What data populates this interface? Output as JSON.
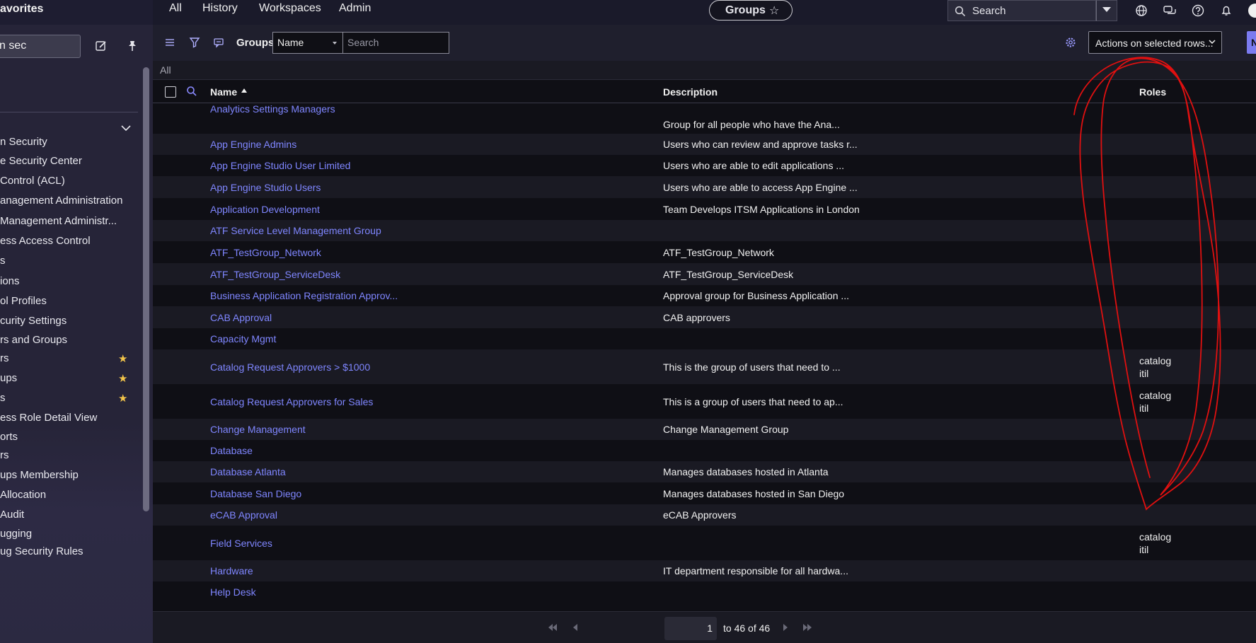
{
  "top_nav": {
    "favorites_label": "avorites",
    "menus": [
      "All",
      "History",
      "Workspaces",
      "Admin"
    ],
    "workspace_title": "Groups",
    "search_label": "Search"
  },
  "sidebar": {
    "filter_value": "n sec",
    "items": [
      {
        "label": "n Security",
        "starred": false
      },
      {
        "label": "e Security Center",
        "starred": false
      },
      {
        "label": "Control (ACL)",
        "starred": false
      },
      {
        "label": "anagement Administration",
        "starred": false
      },
      {
        "label": "Management Administr...",
        "starred": false
      },
      {
        "label": "ess Access Control",
        "starred": false
      },
      {
        "label": "s",
        "starred": false
      },
      {
        "label": "ions",
        "starred": false
      },
      {
        "label": "ol Profiles",
        "starred": false
      },
      {
        "label": "curity Settings",
        "starred": false
      },
      {
        "label": "rs and Groups",
        "starred": false
      },
      {
        "label": "rs",
        "starred": true
      },
      {
        "label": "ups",
        "starred": true
      },
      {
        "label": "s",
        "starred": true
      },
      {
        "label": "ess Role Detail View",
        "starred": false
      },
      {
        "label": "orts",
        "starred": false
      },
      {
        "label": "rs",
        "starred": false
      },
      {
        "label": "ups Membership",
        "starred": false
      },
      {
        "label": "Allocation",
        "starred": false
      },
      {
        "label": "Audit",
        "starred": false
      },
      {
        "label": "ugging",
        "starred": false
      },
      {
        "label": "ug Security Rules",
        "starred": false
      }
    ]
  },
  "list": {
    "title": "Groups",
    "field_select": "Name",
    "search_placeholder": "Search",
    "actions_label": "Actions on selected rows...",
    "new_button": "N",
    "breadcrumb": "All",
    "columns": {
      "name": "Name",
      "description": "Description",
      "roles": "Roles"
    },
    "rows": [
      {
        "name": "Analytics Settings Managers",
        "description": "Group for all people who have the Ana...",
        "roles": []
      },
      {
        "name": "App Engine Admins",
        "description": "Users who can review and approve tasks r...",
        "roles": []
      },
      {
        "name": "App Engine Studio User Limited",
        "description": "Users who are able to edit applications ...",
        "roles": []
      },
      {
        "name": "App Engine Studio Users",
        "description": "Users who are able to access App Engine ...",
        "roles": []
      },
      {
        "name": "Application Development",
        "description": "Team Develops ITSM Applications in London",
        "roles": []
      },
      {
        "name": "ATF Service Level Management Group",
        "description": "",
        "roles": []
      },
      {
        "name": "ATF_TestGroup_Network",
        "description": "ATF_TestGroup_Network",
        "roles": []
      },
      {
        "name": "ATF_TestGroup_ServiceDesk",
        "description": "ATF_TestGroup_ServiceDesk",
        "roles": []
      },
      {
        "name": "Business Application Registration Approv...",
        "description": "Approval group for Business Application ...",
        "roles": []
      },
      {
        "name": "CAB Approval",
        "description": "CAB approvers",
        "roles": []
      },
      {
        "name": "Capacity Mgmt",
        "description": "",
        "roles": []
      },
      {
        "name": "Catalog Request Approvers > $1000",
        "description": "This is the group of users that need to ...",
        "roles": [
          "catalog",
          "itil"
        ]
      },
      {
        "name": "Catalog Request Approvers for Sales",
        "description": "This is a group of users that need to ap...",
        "roles": [
          "catalog",
          "itil"
        ]
      },
      {
        "name": "Change Management",
        "description": "Change Management Group",
        "roles": []
      },
      {
        "name": "Database",
        "description": "",
        "roles": []
      },
      {
        "name": "Database Atlanta",
        "description": "Manages databases hosted in Atlanta",
        "roles": []
      },
      {
        "name": "Database San Diego",
        "description": "Manages databases hosted in San Diego",
        "roles": []
      },
      {
        "name": "eCAB Approval",
        "description": "eCAB Approvers",
        "roles": []
      },
      {
        "name": "Field Services",
        "description": "",
        "roles": [
          "catalog",
          "itil"
        ]
      },
      {
        "name": "Hardware",
        "description": "IT department responsible for all hardwa...",
        "roles": []
      },
      {
        "name": "Help Desk",
        "description": "",
        "roles": []
      }
    ]
  },
  "pager": {
    "page": "1",
    "range": "to 46 of 46"
  },
  "colors": {
    "link": "#7f86ff",
    "annotation": "#e01010",
    "star": "#f3c54a"
  }
}
